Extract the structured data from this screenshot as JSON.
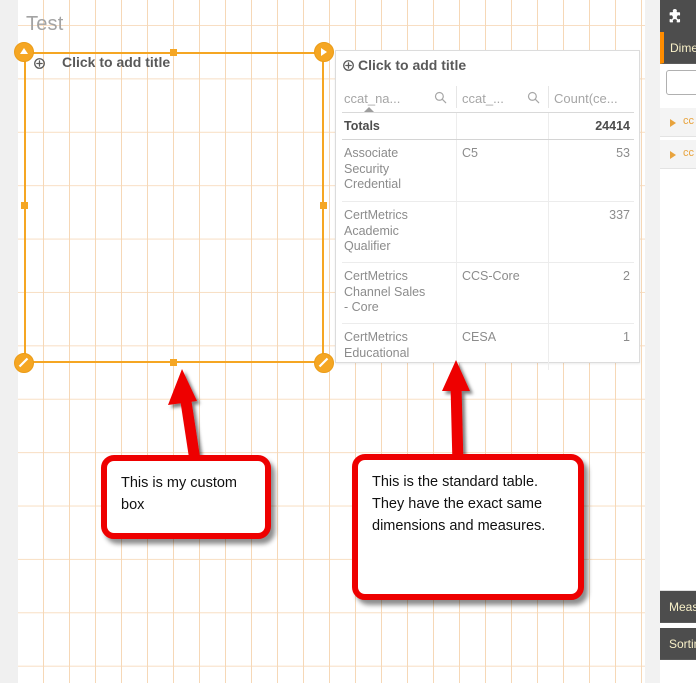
{
  "sheet": {
    "title": "Test"
  },
  "custom_object": {
    "title": "Click to add title",
    "title_icon": "plus-circle-icon",
    "handles": [
      "resize-handle-top-left",
      "resize-handle-top-right",
      "resize-handle-bottom-left",
      "resize-handle-bottom-right"
    ]
  },
  "table_object": {
    "title": "Click to add title",
    "title_icon": "plus-circle-icon",
    "columns": [
      {
        "label": "ccat_na...",
        "search_icon": "search-icon",
        "sorted": true,
        "sort_dir": "asc"
      },
      {
        "label": "ccat_...",
        "search_icon": "search-icon",
        "sorted": false
      },
      {
        "label": "Count(ce...",
        "search_icon": null,
        "sorted": false
      }
    ],
    "totals": {
      "label": "Totals",
      "value": "24414"
    },
    "rows": [
      {
        "dim1": "Associate Security Credential",
        "dim2": "C5",
        "measure": "53"
      },
      {
        "dim1": "CertMetrics Academic Qualifier",
        "dim2": "",
        "measure": "337"
      },
      {
        "dim1": "CertMetrics Channel Sales - Core",
        "dim2": "CCS-Core",
        "measure": "2"
      },
      {
        "dim1": "CertMetrics Educational",
        "dim2": "CESA",
        "measure": "1"
      }
    ]
  },
  "annotations": [
    {
      "id": "custom",
      "text": "This is my custom box"
    },
    {
      "id": "table",
      "text": "This is the standard table. They have the exact same dimensions and measures."
    }
  ],
  "right_panel": {
    "toolbar_icon": "puzzle-piece-icon",
    "sections": [
      {
        "id": "dimensions",
        "label": "Dimensions",
        "active": true
      },
      {
        "id": "measures",
        "label": "Measures",
        "active": false
      },
      {
        "id": "sorting",
        "label": "Sorting",
        "active": false
      }
    ],
    "search": {
      "value": "",
      "placeholder": ""
    },
    "tree_items": [
      {
        "label": "cc",
        "expander_icon": "triangle-right-icon"
      },
      {
        "label": "cc",
        "expander_icon": "triangle-right-icon"
      }
    ]
  },
  "colors": {
    "accent_orange": "#f5a623",
    "grid_line": "#f6d6b4",
    "annotation_red": "#ee0000",
    "panel_dark": "#4d4d4d"
  }
}
